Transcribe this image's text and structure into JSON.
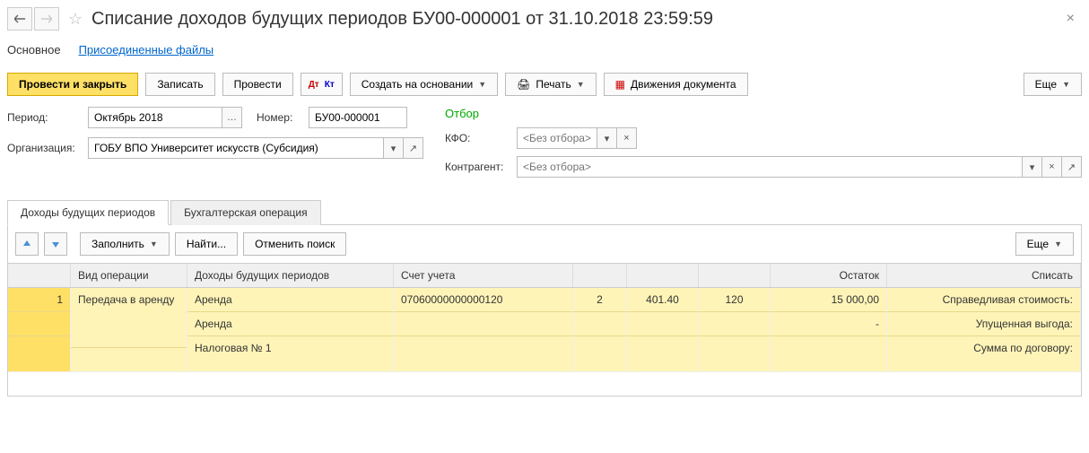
{
  "title": "Списание доходов будущих периодов БУ00-000001 от 31.10.2018 23:59:59",
  "sectionTabs": {
    "main": "Основное",
    "files": "Присоединенные файлы"
  },
  "toolbar": {
    "postClose": "Провести и закрыть",
    "save": "Записать",
    "post": "Провести",
    "createBased": "Создать на основании",
    "print": "Печать",
    "movements": "Движения документа",
    "more": "Еще"
  },
  "form": {
    "periodLabel": "Период:",
    "periodValue": "Октябрь 2018",
    "numberLabel": "Номер:",
    "numberValue": "БУ00-000001",
    "orgLabel": "Организация:",
    "orgValue": "ГОБУ ВПО Университет искусств (Субсидия)"
  },
  "filter": {
    "title": "Отбор",
    "kfoLabel": "КФО:",
    "kfoPlaceholder": "<Без отбора>",
    "contrLabel": "Контрагент:",
    "contrPlaceholder": "<Без отбора>"
  },
  "tabs": {
    "t1": "Доходы будущих периодов",
    "t2": "Бухгалтерская операция"
  },
  "tableToolbar": {
    "fill": "Заполнить",
    "find": "Найти...",
    "cancelFind": "Отменить поиск",
    "more": "Еще"
  },
  "grid": {
    "headers": {
      "num": "",
      "op": "Вид операции",
      "dbp": "Доходы будущих периодов",
      "acc": "Счет учета",
      "rest": "Остаток",
      "write": "Списать"
    },
    "row": {
      "num": "1",
      "op": "Передача в аренду",
      "dbp1": "Аренда",
      "dbp2": "Аренда",
      "dbp3": "Налоговая № 1",
      "acc": "07060000000000120",
      "a1": "2",
      "a2": "401.40",
      "a3": "120",
      "rest": "15 000,00",
      "restDash": "-",
      "w1": "Справедливая стоимость:",
      "w2": "Упущенная выгода:",
      "w3": "Сумма по договору:"
    }
  }
}
